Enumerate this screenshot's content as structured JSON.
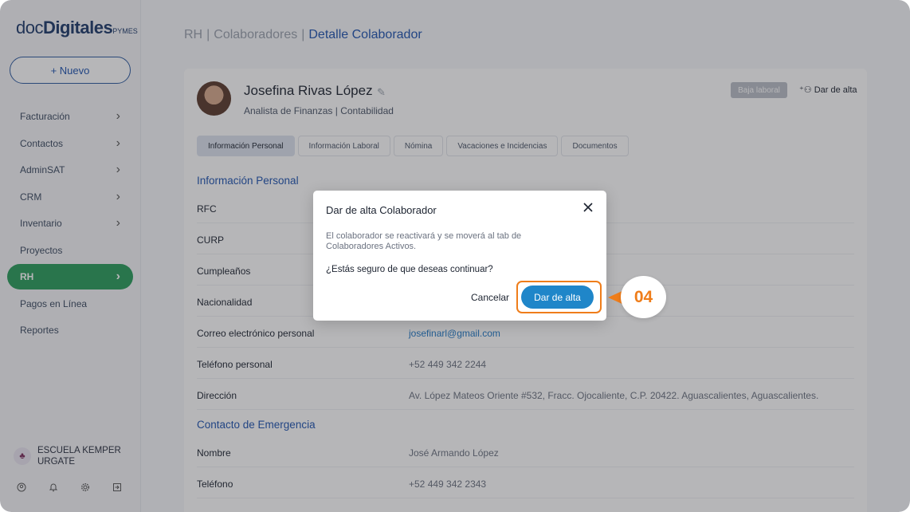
{
  "sidebar": {
    "logo": {
      "part1": "doc",
      "part2": "Digitales",
      "part3": "PYMES"
    },
    "new_button": "+ Nuevo",
    "items": [
      {
        "label": "Facturación",
        "chevron": true
      },
      {
        "label": "Contactos",
        "chevron": true
      },
      {
        "label": "AdminSAT",
        "chevron": true
      },
      {
        "label": "CRM",
        "chevron": true
      },
      {
        "label": "Inventario",
        "chevron": true
      },
      {
        "label": "Proyectos",
        "chevron": false
      },
      {
        "label": "RH",
        "chevron": true,
        "active": true
      },
      {
        "label": "Pagos en Línea",
        "chevron": false
      },
      {
        "label": "Reportes",
        "chevron": false
      }
    ],
    "organization": "ESCUELA KEMPER URGATE",
    "bottom_icons": [
      "user-circle-icon",
      "bell-icon",
      "gear-icon",
      "logout-icon"
    ]
  },
  "breadcrumb": {
    "items": [
      "RH",
      "Colaboradores"
    ],
    "current": "Detalle Colaborador",
    "separator": "|"
  },
  "employee": {
    "name": "Josefina Rivas López",
    "role": "Analista de Finanzas",
    "department": "Contabilidad",
    "status_badge": "Baja laboral",
    "action_link": "Dar de alta"
  },
  "tabs": [
    "Información Personal",
    "Información Laboral",
    "Nómina",
    "Vacaciones e Incidencias",
    "Documentos"
  ],
  "personal_info": {
    "title": "Información Personal",
    "rows": [
      {
        "label": "RFC",
        "value": ""
      },
      {
        "label": "CURP",
        "value": ""
      },
      {
        "label": "Cumpleaños",
        "value": ""
      },
      {
        "label": "Nacionalidad",
        "value": ""
      },
      {
        "label": "Correo electrónico personal",
        "value": "josefinarl@gmail.com"
      },
      {
        "label": "Teléfono personal",
        "value": "+52 449 342 2244"
      },
      {
        "label": "Dirección",
        "value": "Av. López Mateos Oriente #532, Fracc. Ojocaliente, C.P. 20422. Aguascalientes, Aguascalientes."
      }
    ]
  },
  "emergency_contact": {
    "title": "Contacto de Emergencia",
    "rows": [
      {
        "label": "Nombre",
        "value": "José Armando López"
      },
      {
        "label": "Teléfono",
        "value": "+52 449 342 2343"
      }
    ]
  },
  "modal": {
    "title": "Dar de alta Colaborador",
    "body": "El colaborador se reactivará y se moverá al tab de Colaboradores Activos.",
    "question": "¿Estás seguro de que deseas continuar?",
    "cancel_label": "Cancelar",
    "confirm_label": "Dar de alta"
  },
  "step_marker": "04",
  "colors": {
    "brand_blue": "#1f54b0",
    "active_green": "#2a9d5c",
    "confirm_blue": "#1f86c9",
    "highlight_orange": "#ef7d1a"
  }
}
